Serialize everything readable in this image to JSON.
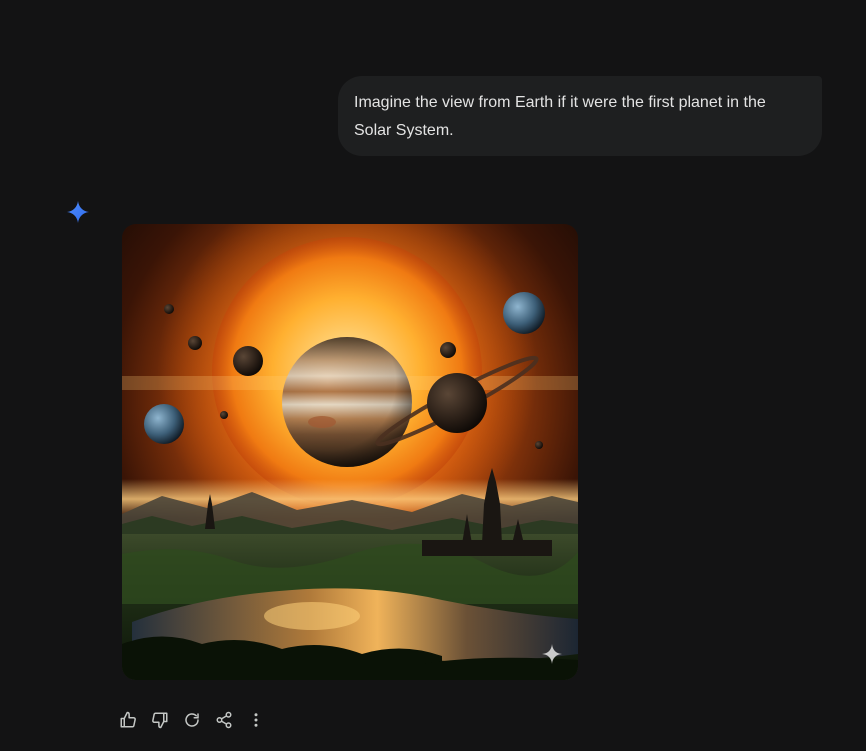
{
  "conversation": {
    "user_prompt": "Imagine the view from Earth if it were the first planet in the Solar System."
  },
  "response": {
    "image": {
      "description_icon": "generated-image",
      "watermark_icon": "sparkle-watermark-icon"
    },
    "actions": [
      {
        "name": "thumb-up-button",
        "icon": "thumb-up-icon"
      },
      {
        "name": "thumb-down-button",
        "icon": "thumb-down-icon"
      },
      {
        "name": "regenerate-button",
        "icon": "refresh-icon"
      },
      {
        "name": "share-button",
        "icon": "share-icon"
      },
      {
        "name": "more-options-button",
        "icon": "more-vertical-icon"
      }
    ]
  },
  "colors": {
    "background": "#131314",
    "bubble": "#1e1f20",
    "text": "#e3e3e3",
    "icon": "#c4c7c5",
    "gemini_blue": "#4285f4"
  }
}
